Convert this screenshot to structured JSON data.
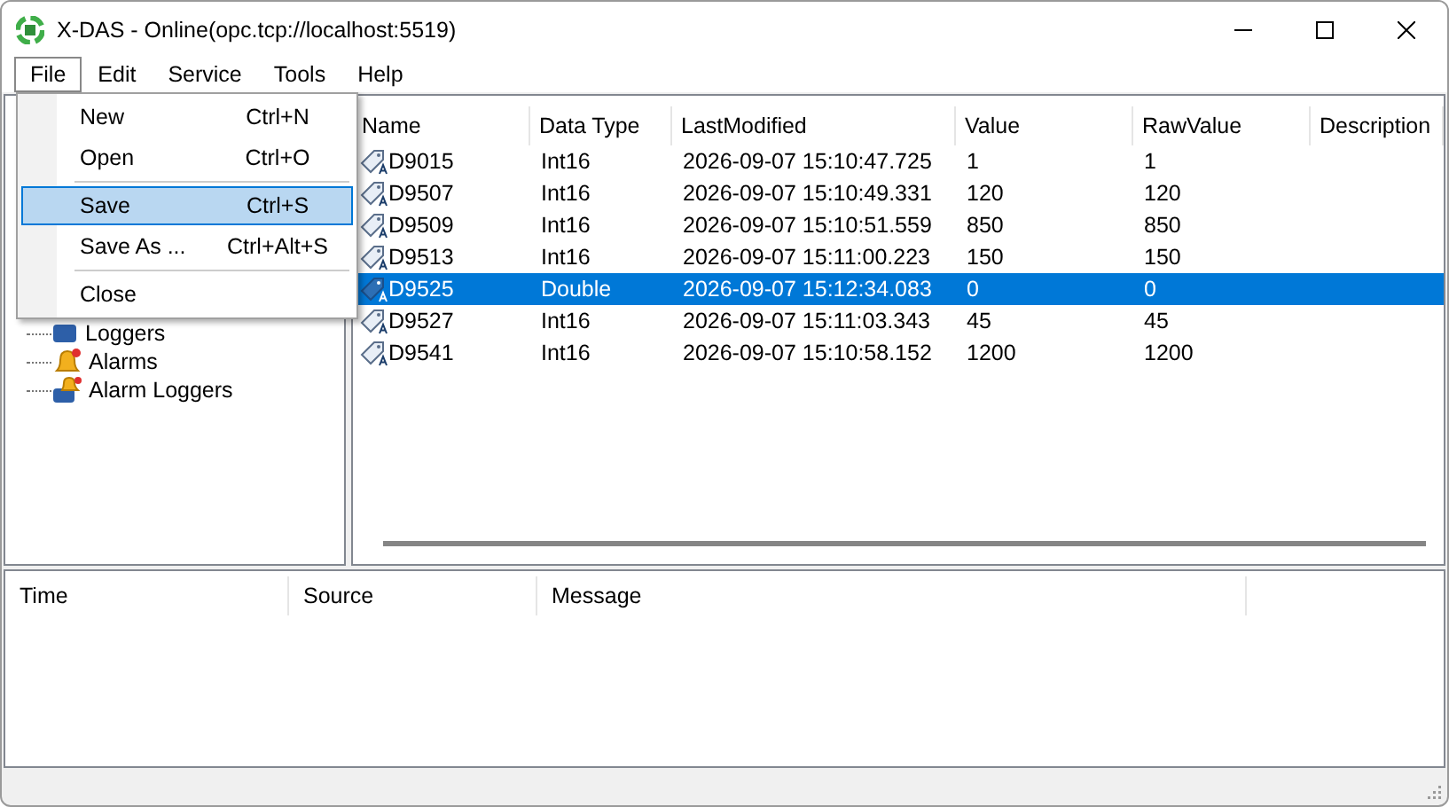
{
  "window": {
    "title": "X-DAS - Online(opc.tcp://localhost:5519)"
  },
  "menu_bar": [
    {
      "label": "File",
      "selected": true
    },
    {
      "label": "Edit",
      "selected": false
    },
    {
      "label": "Service",
      "selected": false
    },
    {
      "label": "Tools",
      "selected": false
    },
    {
      "label": "Help",
      "selected": false
    }
  ],
  "file_menu": [
    {
      "kind": "item",
      "label": "New",
      "shortcut": "Ctrl+N",
      "selected": false
    },
    {
      "kind": "item",
      "label": "Open",
      "shortcut": "Ctrl+O",
      "selected": false
    },
    {
      "kind": "separator"
    },
    {
      "kind": "item",
      "label": "Save",
      "shortcut": "Ctrl+S",
      "selected": true
    },
    {
      "kind": "item",
      "label": "Save As ...",
      "shortcut": "Ctrl+Alt+S",
      "selected": false
    },
    {
      "kind": "separator"
    },
    {
      "kind": "item",
      "label": "Close",
      "selected": false
    }
  ],
  "tree": [
    {
      "label": "Loggers",
      "kind": "loggers"
    },
    {
      "label": "Alarms",
      "kind": "alarms"
    },
    {
      "label": "Alarm Loggers",
      "kind": "alarm-loggers"
    }
  ],
  "tags_table": {
    "columns": [
      "Name",
      "Data Type",
      "LastModified",
      "Value",
      "RawValue",
      "Description"
    ],
    "rows": [
      {
        "cells": [
          "D9015",
          "Int16",
          "2026-09-07 15:10:47.725",
          "1",
          "1"
        ],
        "selected": false
      },
      {
        "cells": [
          "D9507",
          "Int16",
          "2026-09-07 15:10:49.331",
          "120",
          "120"
        ],
        "selected": false
      },
      {
        "cells": [
          "D9509",
          "Int16",
          "2026-09-07 15:10:51.559",
          "850",
          "850"
        ],
        "selected": false
      },
      {
        "cells": [
          "D9513",
          "Int16",
          "2026-09-07 15:11:00.223",
          "150",
          "150"
        ],
        "selected": false
      },
      {
        "cells": [
          "D9525",
          "Double",
          "2026-09-07 15:12:34.083",
          "0",
          "0"
        ],
        "selected": true
      },
      {
        "cells": [
          "D9527",
          "Int16",
          "2026-09-07 15:11:03.343",
          "45",
          "45"
        ],
        "selected": false
      },
      {
        "cells": [
          "D9541",
          "Int16",
          "2026-09-07 15:10:58.152",
          "1200",
          "1200"
        ],
        "selected": false
      }
    ]
  },
  "log_table": {
    "columns": [
      "Time",
      "Source",
      "Message"
    ]
  }
}
